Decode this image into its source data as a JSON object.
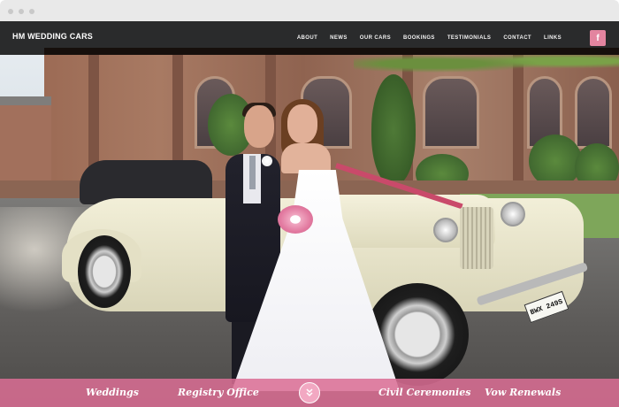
{
  "site": {
    "brand": "HM WEDDING CARS"
  },
  "nav": {
    "items": [
      "ABOUT",
      "NEWS",
      "OUR CARS",
      "BOOKINGS",
      "TESTIMONIALS",
      "CONTACT",
      "LINKS"
    ],
    "facebook_label": "f"
  },
  "hero": {
    "plate_text": "BWX 249S"
  },
  "bottom_bar": {
    "links": [
      "Weddings",
      "Registry Office",
      "Civil Ceremonies",
      "Vow Renewals"
    ],
    "scroll_icon": "chevron-double-down-icon"
  },
  "colors": {
    "nav_bg": "#000000",
    "accent_pink": "#db6e94",
    "facebook_pink": "#e3849f"
  }
}
